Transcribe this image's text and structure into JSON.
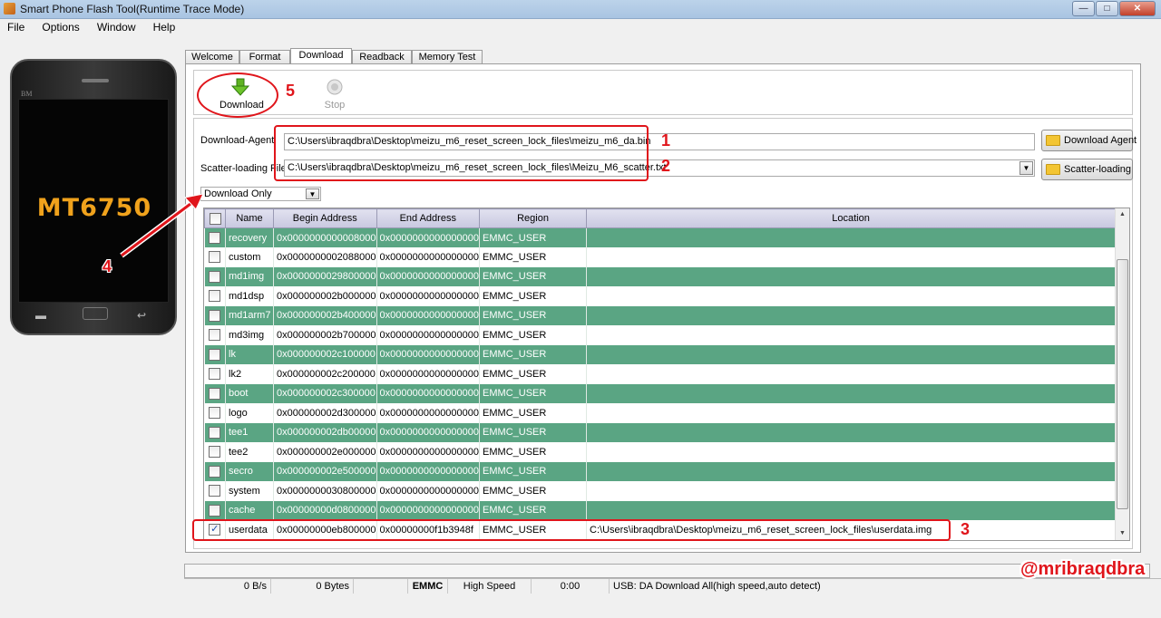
{
  "window": {
    "title": "Smart Phone Flash Tool(Runtime Trace Mode)",
    "min_symbol": "—",
    "max_symbol": "□",
    "close_symbol": "✕"
  },
  "menu": [
    "File",
    "Options",
    "Window",
    "Help"
  ],
  "phone": {
    "brand": "BM",
    "chip": "MT6750"
  },
  "tabs": [
    "Welcome",
    "Format",
    "Download",
    "Readback",
    "Memory Test"
  ],
  "active_tab": "Download",
  "toolbar": {
    "download_label": "Download",
    "stop_label": "Stop",
    "download_icon": "green-down-arrow-icon",
    "stop_icon": "stop-circle-icon"
  },
  "download_agent": {
    "label": "Download-Agent",
    "value": "C:\\Users\\ibraqdbra\\Desktop\\meizu_m6_reset_screen_lock_files\\meizu_m6_da.bin",
    "button": "Download Agent"
  },
  "scatter": {
    "label": "Scatter-loading File",
    "value": "C:\\Users\\ibraqdbra\\Desktop\\meizu_m6_reset_screen_lock_files\\Meizu_M6_scatter.txt",
    "button": "Scatter-loading"
  },
  "mode": {
    "selected": "Download Only"
  },
  "table": {
    "headers": [
      "Name",
      "Begin Address",
      "End Address",
      "Region",
      "Location"
    ],
    "rows": [
      {
        "checked": false,
        "name": "recovery",
        "begin": "0x0000000000008000",
        "end": "0x0000000000000000",
        "region": "EMMC_USER",
        "location": ""
      },
      {
        "checked": false,
        "name": "custom",
        "begin": "0x0000000002088000",
        "end": "0x0000000000000000",
        "region": "EMMC_USER",
        "location": ""
      },
      {
        "checked": false,
        "name": "md1img",
        "begin": "0x0000000029800000",
        "end": "0x0000000000000000",
        "region": "EMMC_USER",
        "location": ""
      },
      {
        "checked": false,
        "name": "md1dsp",
        "begin": "0x000000002b000000",
        "end": "0x0000000000000000",
        "region": "EMMC_USER",
        "location": ""
      },
      {
        "checked": false,
        "name": "md1arm7",
        "begin": "0x000000002b400000",
        "end": "0x0000000000000000",
        "region": "EMMC_USER",
        "location": ""
      },
      {
        "checked": false,
        "name": "md3img",
        "begin": "0x000000002b700000",
        "end": "0x0000000000000000",
        "region": "EMMC_USER",
        "location": ""
      },
      {
        "checked": false,
        "name": "lk",
        "begin": "0x000000002c100000",
        "end": "0x0000000000000000",
        "region": "EMMC_USER",
        "location": ""
      },
      {
        "checked": false,
        "name": "lk2",
        "begin": "0x000000002c200000",
        "end": "0x0000000000000000",
        "region": "EMMC_USER",
        "location": ""
      },
      {
        "checked": false,
        "name": "boot",
        "begin": "0x000000002c300000",
        "end": "0x0000000000000000",
        "region": "EMMC_USER",
        "location": ""
      },
      {
        "checked": false,
        "name": "logo",
        "begin": "0x000000002d300000",
        "end": "0x0000000000000000",
        "region": "EMMC_USER",
        "location": ""
      },
      {
        "checked": false,
        "name": "tee1",
        "begin": "0x000000002db00000",
        "end": "0x0000000000000000",
        "region": "EMMC_USER",
        "location": ""
      },
      {
        "checked": false,
        "name": "tee2",
        "begin": "0x000000002e000000",
        "end": "0x0000000000000000",
        "region": "EMMC_USER",
        "location": ""
      },
      {
        "checked": false,
        "name": "secro",
        "begin": "0x000000002e500000",
        "end": "0x0000000000000000",
        "region": "EMMC_USER",
        "location": ""
      },
      {
        "checked": false,
        "name": "system",
        "begin": "0x0000000030800000",
        "end": "0x0000000000000000",
        "region": "EMMC_USER",
        "location": ""
      },
      {
        "checked": false,
        "name": "cache",
        "begin": "0x00000000d0800000",
        "end": "0x0000000000000000",
        "region": "EMMC_USER",
        "location": ""
      },
      {
        "checked": true,
        "name": "userdata",
        "begin": "0x00000000eb800000",
        "end": "0x00000000f1b3948f",
        "region": "EMMC_USER",
        "location": "C:\\Users\\ibraqdbra\\Desktop\\meizu_m6_reset_screen_lock_files\\userdata.img"
      }
    ]
  },
  "annotations": [
    "1",
    "2",
    "3",
    "4",
    "5"
  ],
  "status": {
    "speed": "0 B/s",
    "bytes": "0 Bytes",
    "storage": "EMMC",
    "mode": "High Speed",
    "time": "0:00",
    "usb": "USB: DA Download All(high speed,auto detect)"
  },
  "watermark": "@mribraqdbra",
  "colors": {
    "row_green": "#5aa583",
    "annotation_red": "#e0151b",
    "chip_orange": "#f0a21c"
  }
}
